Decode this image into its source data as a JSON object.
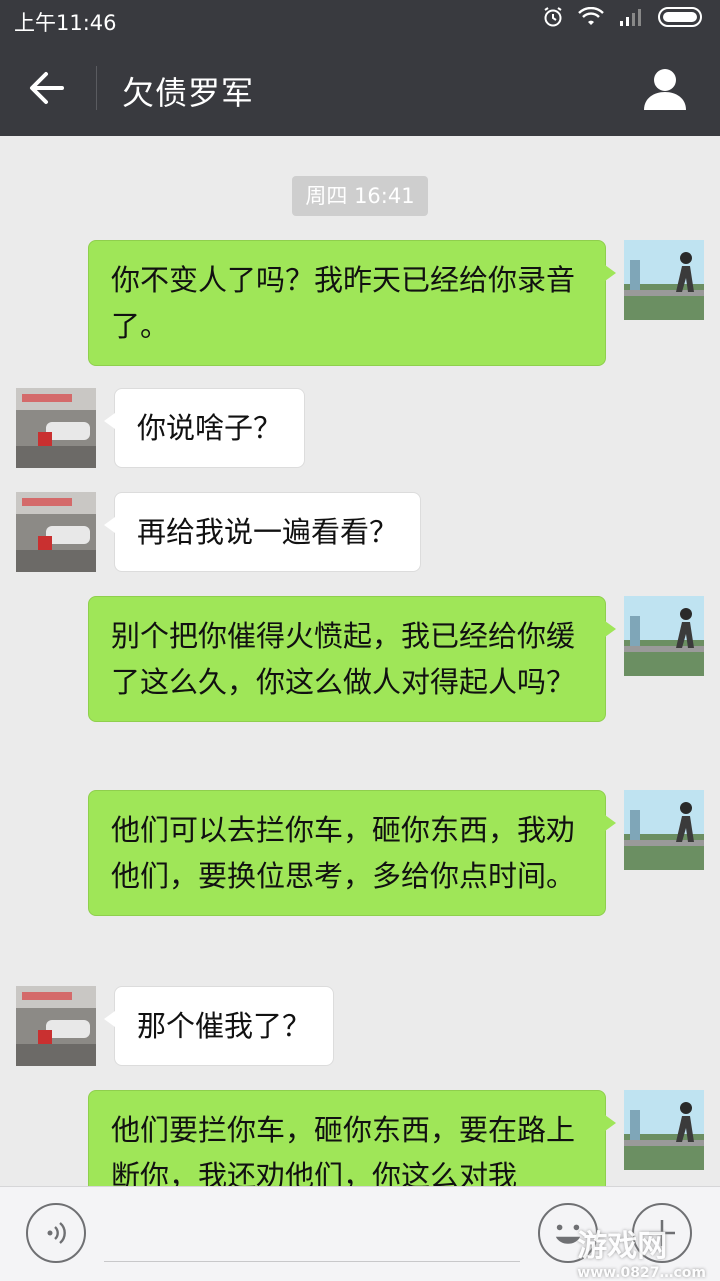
{
  "status_bar": {
    "time": "上午11:46"
  },
  "header": {
    "title": "欠债罗军"
  },
  "chat": {
    "timestamp": "周四 16:41",
    "messages": [
      {
        "from": "me",
        "text": "你不变人了吗？我昨天已经给你录音了。"
      },
      {
        "from": "them",
        "text": "你说啥子？"
      },
      {
        "from": "them",
        "text": "再给我说一遍看看？"
      },
      {
        "from": "me",
        "text": "别个把你催得火愤起，我已经给你缓了这么久，你这么做人对得起人吗？"
      },
      {
        "from": "me",
        "text": "他们可以去拦你车，砸你东西，我劝他们，要换位思考，多给你点时间。"
      },
      {
        "from": "them",
        "text": "那个催我了？"
      },
      {
        "from": "me",
        "text": "他们要拦你车，砸你东西，要在路上断你，我还劝他们，你这么对我"
      }
    ]
  },
  "watermark": {
    "line1": "游戏网",
    "line2": "www.0827…com"
  },
  "colors": {
    "header_bg": "#393a3f",
    "outgoing_bubble": "#9fe658",
    "incoming_bubble": "#ffffff",
    "chat_bg": "#ebebeb"
  }
}
